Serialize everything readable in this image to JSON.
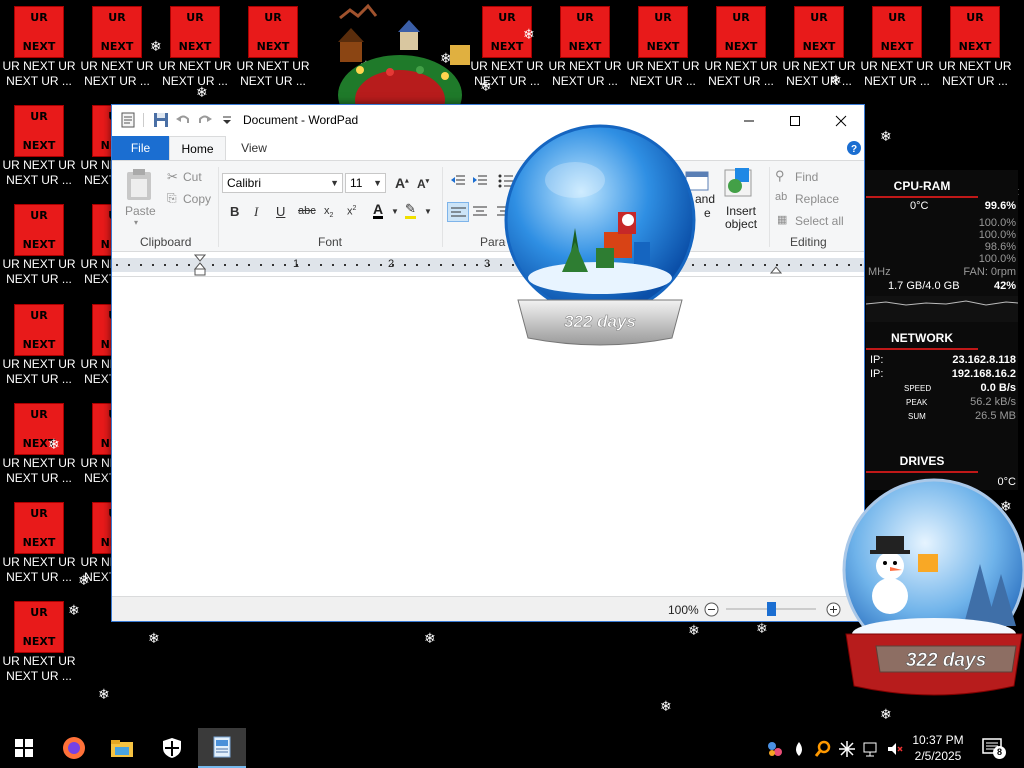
{
  "desktop": {
    "tile_top": "UR",
    "tile_bottom": "NEXT",
    "caption_line1": "UR NEXT UR",
    "caption_line2": "NEXT UR ...",
    "caption_first_line1": "UR NEXT UR",
    "caption_first_line2": "NEXT UR ..."
  },
  "wordpad": {
    "title": "Document - WordPad",
    "tabs": [
      "File",
      "Home",
      "View"
    ],
    "clipboard": {
      "paste": "Paste",
      "cut": "Cut",
      "copy": "Copy",
      "label": "Clipboard"
    },
    "font": {
      "family": "Calibri",
      "size": "11",
      "label": "Font"
    },
    "paragraph": {
      "label": "Paragraph"
    },
    "insert": {
      "picture_label": "and",
      "picture_label2": "e",
      "object_label": "Insert",
      "object_label2": "object"
    },
    "editing": {
      "find": "Find",
      "replace": "Replace",
      "select_all": "Select all",
      "label": "Editing"
    },
    "ruler_numbers": [
      "1",
      "2",
      "3"
    ],
    "zoom": "100%",
    "zoom_level": 1.0
  },
  "globe_top": {
    "days": "322 days"
  },
  "globe_bottom": {
    "days": "322 days"
  },
  "gadget": {
    "cpu": {
      "title": "CPU-RAM",
      "temp": "0°C",
      "load": "99.6%",
      "cores": [
        "100.0%",
        "100.0%",
        "98.6%",
        "100.0%"
      ],
      "mhz": "MHz",
      "fan": "FAN: 0rpm",
      "ram": "1.7 GB/4.0 GB",
      "ram_pct": "42%"
    },
    "network": {
      "title": "NETWORK",
      "ip_label": "IP:",
      "ip_public": "23.162.8.118",
      "ip_local": "192.168.16.2",
      "speed_label": "SPEED",
      "speed": "0.0 B/s",
      "peak_label": "PEAK",
      "peak": "56.2 kB/s",
      "sum_label": "SUM",
      "sum": "26.5 MB"
    },
    "drives": {
      "title": "DRIVES",
      "temp": "0°C"
    }
  },
  "taskbar": {
    "time": "10:37 PM",
    "date": "2/5/2025",
    "notifications": "8"
  },
  "colors": {
    "tile_red": "#e81a1a",
    "file_tab_blue": "#1b6ed1",
    "gadget_red": "#c01818"
  }
}
